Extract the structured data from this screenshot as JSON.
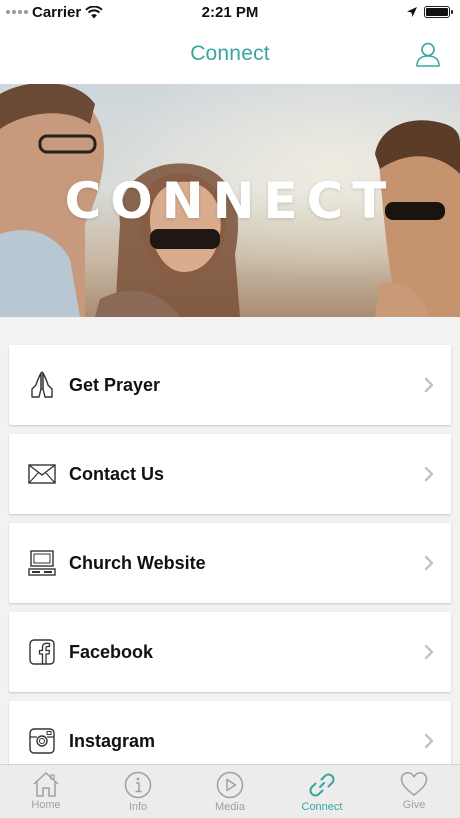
{
  "status_bar": {
    "carrier": "Carrier",
    "time": "2:21 PM"
  },
  "nav": {
    "title": "Connect",
    "profile_icon": "person-icon"
  },
  "hero": {
    "overlay_text": "CONNECT"
  },
  "list": {
    "items": [
      {
        "label": "Get Prayer",
        "icon": "praying-hands-icon"
      },
      {
        "label": "Contact Us",
        "icon": "envelope-icon"
      },
      {
        "label": "Church Website",
        "icon": "laptop-icon"
      },
      {
        "label": "Facebook",
        "icon": "facebook-icon"
      },
      {
        "label": "Instagram",
        "icon": "instagram-icon"
      }
    ]
  },
  "tab_bar": {
    "tabs": [
      {
        "label": "Home",
        "icon": "home-icon"
      },
      {
        "label": "Info",
        "icon": "info-icon"
      },
      {
        "label": "Media",
        "icon": "play-icon"
      },
      {
        "label": "Connect",
        "icon": "link-icon",
        "active": true
      },
      {
        "label": "Give",
        "icon": "heart-icon"
      }
    ]
  },
  "colors": {
    "accent": "#3aa5a0",
    "inactive": "#a0a0a0"
  }
}
